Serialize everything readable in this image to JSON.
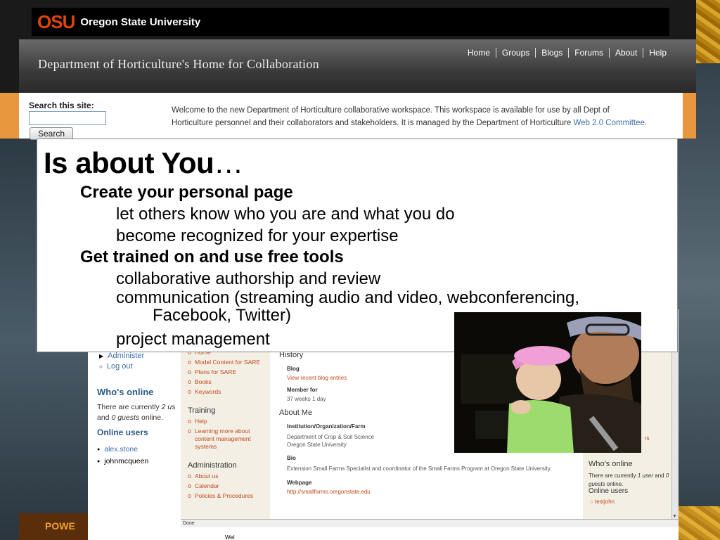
{
  "osu": {
    "mark": "OSU",
    "name": "Oregon State University"
  },
  "header": {
    "title": "Department of Horticulture's Home for Collaboration",
    "nav": [
      "Home",
      "Groups",
      "Blogs",
      "Forums",
      "About",
      "Help"
    ]
  },
  "search": {
    "label": "Search this site:",
    "value": "",
    "button": "Search"
  },
  "welcome": {
    "text": "Welcome to the new Department of Horticulture collaborative workspace. This workspace is available for use by all Dept of Horticulture personnel and their collaborators and stakeholders. It is managed by the Department of Horticulture ",
    "link": "Web 2.0 Committee",
    "end": "."
  },
  "slide": {
    "title": "Is about You",
    "ellipsis": "…",
    "heading1": "Create your personal page",
    "item1": "let others know who you are and what you do",
    "item2": "become recognized for your expertise",
    "heading2": "Get trained on and use free tools",
    "item3": "collaborative authorship and review",
    "item4a": "communication (streaming audio and video, webconferencing,",
    "item4b": "Facebook, Twitter)",
    "item5": "project management"
  },
  "bottom": {
    "admin_items": [
      "Administer",
      "Log out"
    ],
    "who_online": "Who's online",
    "who_text_1": "There are currently ",
    "who_text_2": "2 us",
    "who_text_3": "and ",
    "who_text_4": "0 guests",
    "who_text_5": " online.",
    "online_users": "Online users",
    "users": [
      "alex.stone",
      "johnmcqueen"
    ],
    "nav_top_items": [
      "Model Content for SARE",
      "Plans for SARE",
      "Books",
      "Keywords"
    ],
    "nav_top_first": "Home",
    "training": "Training",
    "training_items": [
      "Help",
      "Learning more about content management systems"
    ],
    "administration": "Administration",
    "admin_nav_items": [
      "About us",
      "Calendar",
      "Policies & Procedures"
    ],
    "history": "History",
    "blog_label": "Blog",
    "blog_link": "View recent blog entries",
    "member_label": "Member for",
    "member_value": "37 weeks 1 day",
    "about_me": "About Me",
    "inst_label": "Institution/Organization/Farm",
    "inst_value_1": "Department of Crop & Soil Science",
    "inst_value_2": "Oregon State University",
    "bio_label": "Bio",
    "bio_value": "Extension Small Farms Specialist and coordinator of the Small Farms Program at Oregon State University.",
    "web_label": "Webpage",
    "web_link": "http://smallfarms.oregonstate.edu",
    "right_who": "Who's online",
    "right_text_1": "There are currently ",
    "right_text_2": "1 user",
    "right_text_3": " and ",
    "right_text_4": "0 guests",
    "right_text_5": " online.",
    "right_online_users": "Online users",
    "right_user": "testjohn",
    "right_peek": "rs",
    "status": "Done",
    "peek": "Wel",
    "pow": "POWE"
  },
  "colors": {
    "osu_orange": "#dc4405",
    "link_blue": "#3b6fa8",
    "link_rust": "#c04a20"
  }
}
